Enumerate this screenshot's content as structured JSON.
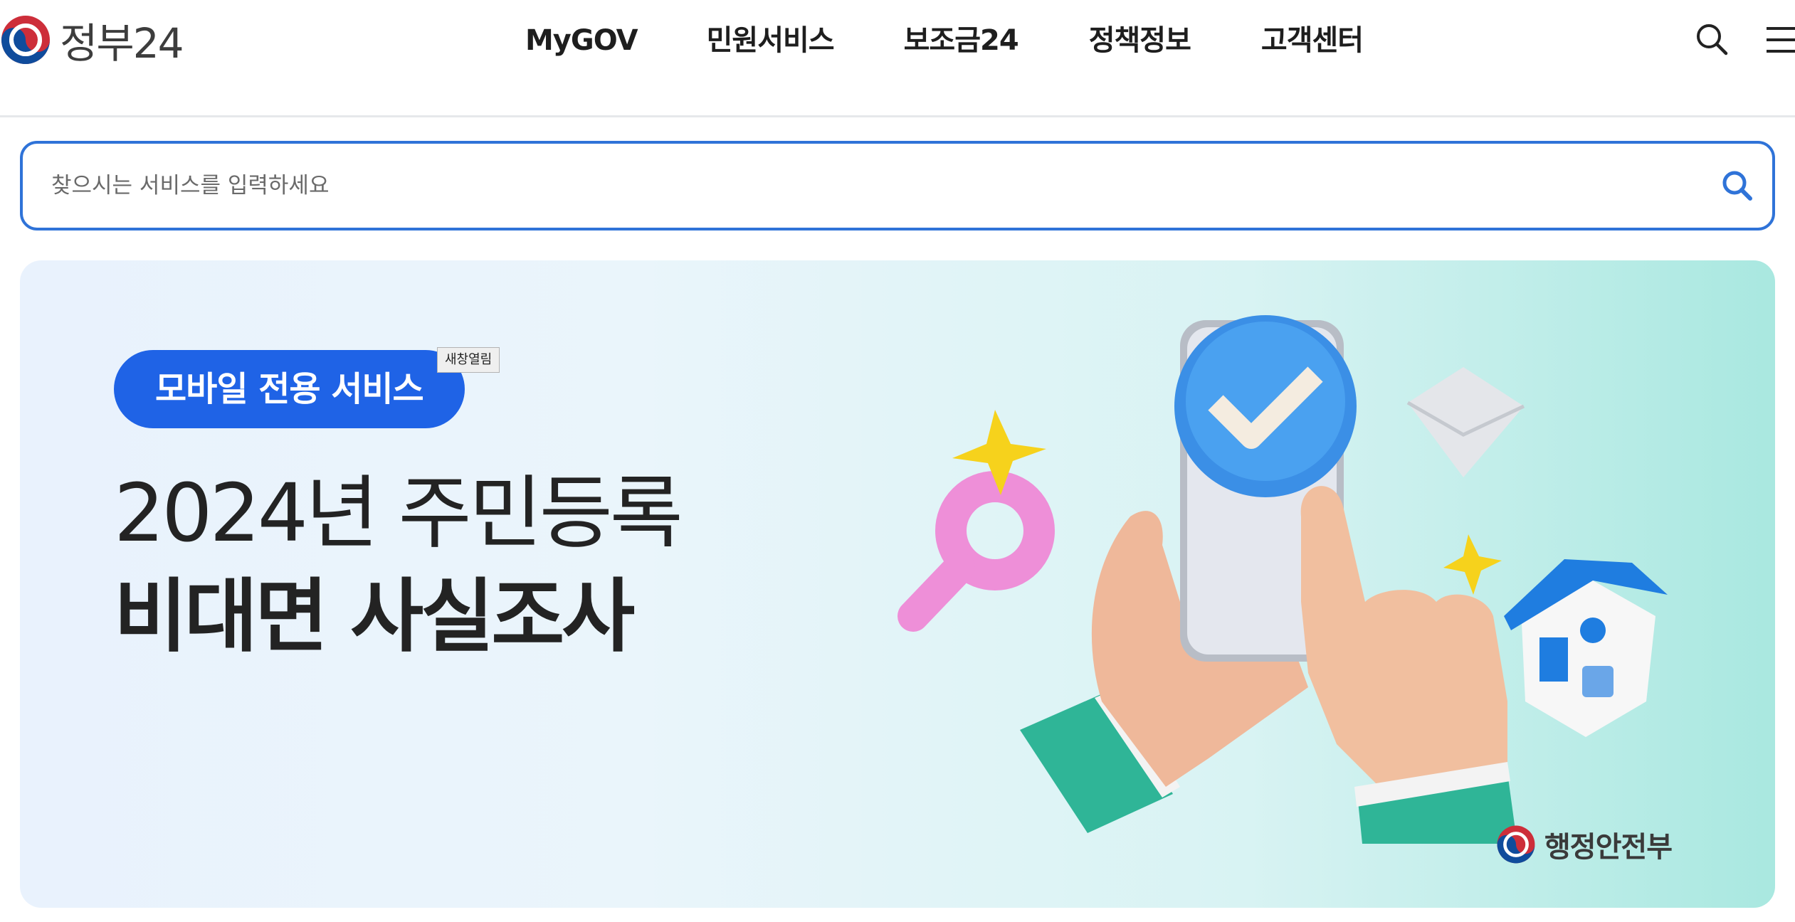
{
  "header": {
    "logo_text": "정부24",
    "nav": [
      "MyGOV",
      "민원서비스",
      "보조금24",
      "정책정보",
      "고객센터"
    ],
    "icons": {
      "search": "search-icon",
      "menu": "hamburger-menu-icon"
    }
  },
  "search": {
    "placeholder": "찾으시는 서비스를 입력하세요",
    "value": ""
  },
  "banner": {
    "badge": "모바일 전용 서비스",
    "tooltip": "새창열림",
    "title_line1": "2024년 주민등록",
    "title_line2": "비대면 사실조사",
    "ministry": "행정안전부"
  },
  "colors": {
    "accent": "#2f73d8",
    "badge": "#1f63e6",
    "taeguk_red": "#cd2e3a",
    "taeguk_blue": "#0f4c9c"
  }
}
